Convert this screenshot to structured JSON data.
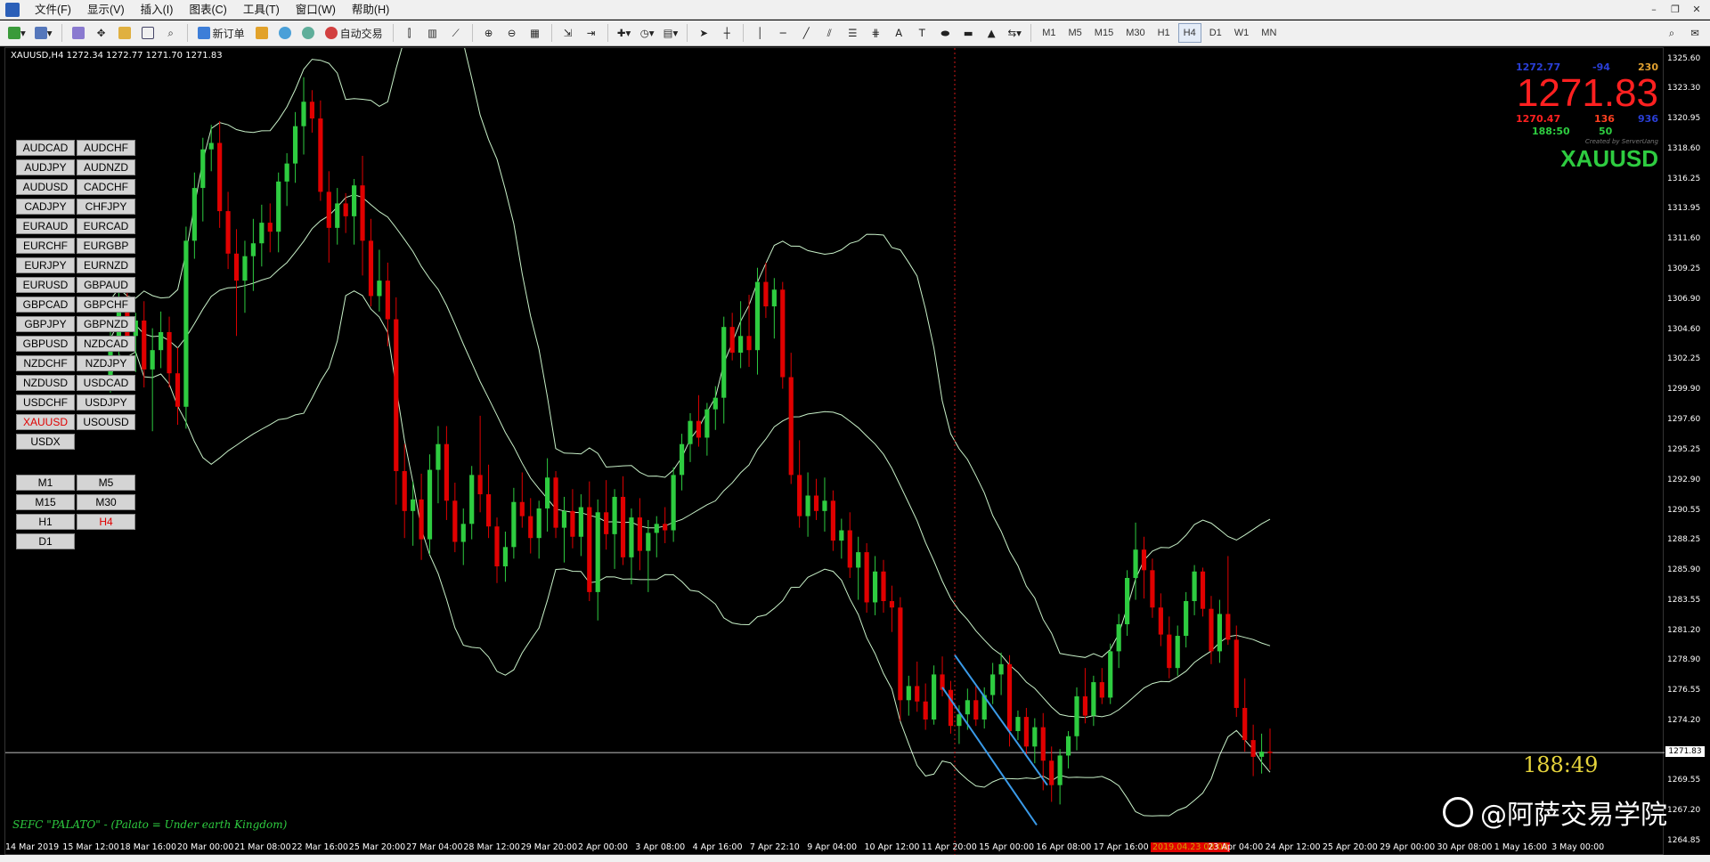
{
  "menu": [
    "文件(F)",
    "显示(V)",
    "插入(I)",
    "图表(C)",
    "工具(T)",
    "窗口(W)",
    "帮助(H)"
  ],
  "toolbar": {
    "new_order": "新订单",
    "auto_trade": "自动交易",
    "timeframes": [
      "M1",
      "M5",
      "M15",
      "M30",
      "H1",
      "H4",
      "D1",
      "W1",
      "MN"
    ],
    "active_timeframe": "H4"
  },
  "chart": {
    "header": "XAUUSD,H4  1272.34 1272.77 1271.70 1271.83",
    "watermark": "SEFC \"PALATO\" - (Palato = Under earth Kingdom)",
    "timer": "188:49",
    "current_price_label": "1271.83",
    "price_axis": [
      "1325.60",
      "1323.30",
      "1320.95",
      "1318.60",
      "1316.25",
      "1313.95",
      "1311.60",
      "1309.25",
      "1306.90",
      "1304.60",
      "1302.25",
      "1299.90",
      "1297.60",
      "1295.25",
      "1292.90",
      "1290.55",
      "1288.25",
      "1285.90",
      "1283.55",
      "1281.20",
      "1278.90",
      "1276.55",
      "1274.20",
      "1271.83",
      "1269.55",
      "1267.20",
      "1264.85"
    ],
    "time_axis": [
      "14 Mar 2019",
      "15 Mar 12:00",
      "18 Mar 16:00",
      "20 Mar 00:00",
      "21 Mar 08:00",
      "22 Mar 16:00",
      "25 Mar 20:00",
      "27 Mar 04:00",
      "28 Mar 12:00",
      "29 Mar 20:00",
      "2 Apr 00:00",
      "3 Apr 08:00",
      "4 Apr 16:00",
      "7 Apr 22:10",
      "9 Apr 04:00",
      "10 Apr 12:00",
      "11 Apr 20:00",
      "15 Apr 00:00",
      "16 Apr 08:00",
      "17 Apr 16:00",
      "2019.04.23 08:00",
      "23 Apr 04:00",
      "24 Apr 12:00",
      "25 Apr 20:00",
      "29 Apr 00:00",
      "30 Apr 08:00",
      "1 May 16:00",
      "3 May 00:00"
    ],
    "highlighted_time": "2019.04.23 08:00"
  },
  "info_panel": {
    "ask": "1272.77",
    "spread": "-94",
    "value_right": "230",
    "bid_big": "1271.83",
    "low": "1270.47",
    "pips": "136",
    "value_blue": "936",
    "timer_green": "188:50",
    "value_green": "50",
    "credit": "Created by ServerUang",
    "symbol": "XAUUSD",
    "colors": {
      "ask": "#2a3fd8",
      "spread": "#2a3fd8",
      "value_right": "#e0a030",
      "bid": "#ff2020",
      "low": "#ff2020",
      "pips": "#ff4020",
      "value_blue": "#2a3fd8",
      "green": "#2ecc40"
    }
  },
  "symbols": [
    "AUDCAD",
    "AUDCHF",
    "AUDJPY",
    "AUDNZD",
    "AUDUSD",
    "CADCHF",
    "CADJPY",
    "CHFJPY",
    "EURAUD",
    "EURCAD",
    "EURCHF",
    "EURGBP",
    "EURJPY",
    "EURNZD",
    "EURUSD",
    "GBPAUD",
    "GBPCAD",
    "GBPCHF",
    "GBPJPY",
    "GBPNZD",
    "GBPUSD",
    "NZDCAD",
    "NZDCHF",
    "NZDJPY",
    "NZDUSD",
    "USDCAD",
    "USDCHF",
    "USDJPY",
    "XAUUSD",
    "USOUSD",
    "USDX"
  ],
  "active_symbol": "XAUUSD",
  "timeframe_buttons": [
    "M1",
    "M5",
    "M15",
    "M30",
    "H1",
    "H4",
    "D1"
  ],
  "brand": "@阿萨交易学院",
  "chart_data": {
    "type": "candlestick",
    "ylim": [
      1264.85,
      1325.6
    ],
    "bull_color": "#2ecc40",
    "bear_color": "#e00000",
    "candles": [
      [
        1300.5,
        1305.2,
        1299.8,
        1304.0
      ],
      [
        1304.0,
        1307.9,
        1302.5,
        1306.6
      ],
      [
        1306.6,
        1308.3,
        1303.1,
        1304.2
      ],
      [
        1304.2,
        1306.0,
        1301.4,
        1305.4
      ],
      [
        1305.4,
        1306.9,
        1300.2,
        1301.6
      ],
      [
        1301.6,
        1304.8,
        1296.8,
        1303.1
      ],
      [
        1303.1,
        1306.1,
        1301.7,
        1304.5
      ],
      [
        1304.5,
        1305.7,
        1300.2,
        1301.3
      ],
      [
        1301.3,
        1303.3,
        1297.3,
        1298.7
      ],
      [
        1298.7,
        1312.7,
        1297.0,
        1311.6
      ],
      [
        1311.6,
        1316.9,
        1310.2,
        1315.7
      ],
      [
        1315.7,
        1319.6,
        1313.1,
        1318.7
      ],
      [
        1318.7,
        1320.6,
        1317.0,
        1319.2
      ],
      [
        1319.2,
        1320.9,
        1312.6,
        1313.9
      ],
      [
        1313.9,
        1315.4,
        1309.4,
        1310.6
      ],
      [
        1310.6,
        1312.5,
        1304.2,
        1308.5
      ],
      [
        1308.5,
        1311.6,
        1306.0,
        1310.4
      ],
      [
        1310.4,
        1313.3,
        1307.7,
        1311.4
      ],
      [
        1311.4,
        1314.4,
        1309.6,
        1313.0
      ],
      [
        1313.0,
        1314.5,
        1310.7,
        1312.3
      ],
      [
        1312.3,
        1316.9,
        1310.7,
        1316.2
      ],
      [
        1316.2,
        1318.4,
        1314.3,
        1317.6
      ],
      [
        1317.6,
        1321.6,
        1316.1,
        1320.5
      ],
      [
        1320.5,
        1324.3,
        1318.3,
        1322.4
      ],
      [
        1322.4,
        1323.3,
        1320.0,
        1321.1
      ],
      [
        1321.1,
        1322.5,
        1314.7,
        1315.4
      ],
      [
        1315.4,
        1317.0,
        1309.9,
        1312.6
      ],
      [
        1312.6,
        1315.7,
        1311.3,
        1314.5
      ],
      [
        1314.5,
        1315.3,
        1312.2,
        1313.5
      ],
      [
        1313.5,
        1316.4,
        1311.3,
        1315.9
      ],
      [
        1315.9,
        1318.2,
        1308.9,
        1311.6
      ],
      [
        1311.6,
        1313.3,
        1306.5,
        1307.3
      ],
      [
        1307.3,
        1310.9,
        1306.1,
        1308.5
      ],
      [
        1308.5,
        1309.9,
        1303.4,
        1305.5
      ],
      [
        1305.5,
        1307.2,
        1291.1,
        1293.7
      ],
      [
        1293.7,
        1295.8,
        1288.5,
        1290.6
      ],
      [
        1290.6,
        1292.9,
        1287.9,
        1291.5
      ],
      [
        1291.5,
        1293.5,
        1286.8,
        1288.4
      ],
      [
        1288.4,
        1295.0,
        1287.2,
        1293.8
      ],
      [
        1293.8,
        1297.2,
        1291.2,
        1295.8
      ],
      [
        1295.8,
        1297.2,
        1289.9,
        1291.4
      ],
      [
        1291.4,
        1292.8,
        1287.4,
        1288.2
      ],
      [
        1288.2,
        1290.8,
        1286.4,
        1289.6
      ],
      [
        1289.6,
        1294.1,
        1288.4,
        1293.4
      ],
      [
        1293.4,
        1298.0,
        1290.5,
        1291.9
      ],
      [
        1291.9,
        1294.2,
        1288.5,
        1289.4
      ],
      [
        1289.4,
        1290.1,
        1285.0,
        1286.3
      ],
      [
        1286.3,
        1289.0,
        1285.1,
        1287.8
      ],
      [
        1287.8,
        1292.4,
        1286.9,
        1291.3
      ],
      [
        1291.3,
        1293.6,
        1289.3,
        1290.2
      ],
      [
        1290.2,
        1291.6,
        1287.3,
        1288.5
      ],
      [
        1288.5,
        1291.4,
        1286.9,
        1290.8
      ],
      [
        1290.8,
        1294.7,
        1289.0,
        1293.2
      ],
      [
        1293.2,
        1293.7,
        1288.5,
        1289.3
      ],
      [
        1289.3,
        1291.7,
        1286.6,
        1290.6
      ],
      [
        1290.6,
        1292.3,
        1287.7,
        1288.6
      ],
      [
        1288.6,
        1291.9,
        1287.1,
        1290.9
      ],
      [
        1290.9,
        1292.9,
        1283.6,
        1284.3
      ],
      [
        1284.3,
        1291.5,
        1282.1,
        1290.5
      ],
      [
        1290.5,
        1293.0,
        1287.6,
        1288.8
      ],
      [
        1288.8,
        1292.3,
        1286.1,
        1291.7
      ],
      [
        1291.7,
        1293.3,
        1286.4,
        1287.0
      ],
      [
        1287.0,
        1290.8,
        1284.9,
        1290.1
      ],
      [
        1290.1,
        1291.6,
        1286.0,
        1287.5
      ],
      [
        1287.5,
        1289.9,
        1284.3,
        1288.9
      ],
      [
        1288.9,
        1290.2,
        1287.0,
        1289.6
      ],
      [
        1289.6,
        1290.9,
        1288.1,
        1289.1
      ],
      [
        1289.1,
        1294.0,
        1288.2,
        1293.4
      ],
      [
        1293.4,
        1296.6,
        1292.2,
        1295.8
      ],
      [
        1295.8,
        1298.2,
        1294.4,
        1297.6
      ],
      [
        1297.6,
        1299.6,
        1295.6,
        1296.3
      ],
      [
        1296.3,
        1299.0,
        1294.9,
        1298.5
      ],
      [
        1298.5,
        1300.3,
        1296.9,
        1299.4
      ],
      [
        1299.4,
        1305.7,
        1297.4,
        1304.9
      ],
      [
        1304.9,
        1306.0,
        1302.3,
        1302.9
      ],
      [
        1302.9,
        1306.9,
        1301.7,
        1304.2
      ],
      [
        1304.2,
        1307.4,
        1301.8,
        1303.1
      ],
      [
        1303.1,
        1309.5,
        1301.2,
        1308.4
      ],
      [
        1308.4,
        1309.9,
        1305.6,
        1306.5
      ],
      [
        1306.5,
        1308.7,
        1304.0,
        1307.8
      ],
      [
        1307.8,
        1308.4,
        1300.1,
        1301.0
      ],
      [
        1301.0,
        1302.9,
        1292.7,
        1293.4
      ],
      [
        1293.4,
        1296.1,
        1289.3,
        1290.2
      ],
      [
        1290.2,
        1293.6,
        1288.6,
        1291.8
      ],
      [
        1291.8,
        1293.1,
        1289.9,
        1290.6
      ],
      [
        1290.6,
        1293.2,
        1289.0,
        1291.4
      ],
      [
        1291.4,
        1292.2,
        1287.5,
        1288.3
      ],
      [
        1288.3,
        1290.0,
        1286.9,
        1289.1
      ],
      [
        1289.1,
        1290.5,
        1285.4,
        1286.2
      ],
      [
        1286.2,
        1288.6,
        1283.7,
        1287.4
      ],
      [
        1287.4,
        1288.1,
        1282.7,
        1283.5
      ],
      [
        1283.5,
        1287.1,
        1282.5,
        1285.9
      ],
      [
        1285.9,
        1286.8,
        1282.7,
        1283.6
      ],
      [
        1283.6,
        1284.8,
        1281.2,
        1283.1
      ],
      [
        1283.1,
        1283.9,
        1274.3,
        1275.9
      ],
      [
        1275.9,
        1277.8,
        1274.7,
        1277.0
      ],
      [
        1277.0,
        1278.9,
        1275.0,
        1275.8
      ],
      [
        1275.8,
        1277.2,
        1273.6,
        1274.4
      ],
      [
        1274.4,
        1278.6,
        1274.0,
        1277.9
      ],
      [
        1277.9,
        1279.3,
        1276.2,
        1276.7
      ],
      [
        1276.7,
        1277.4,
        1273.3,
        1273.9
      ],
      [
        1273.9,
        1275.5,
        1272.5,
        1274.8
      ],
      [
        1274.8,
        1276.8,
        1273.6,
        1275.9
      ],
      [
        1275.9,
        1277.0,
        1273.9,
        1274.4
      ],
      [
        1274.4,
        1276.9,
        1273.7,
        1276.3
      ],
      [
        1276.3,
        1278.8,
        1275.6,
        1277.9
      ],
      [
        1277.9,
        1279.6,
        1276.3,
        1278.7
      ],
      [
        1278.7,
        1279.4,
        1272.3,
        1273.5
      ],
      [
        1273.5,
        1275.1,
        1272.8,
        1274.6
      ],
      [
        1274.6,
        1275.3,
        1271.6,
        1272.3
      ],
      [
        1272.3,
        1274.5,
        1271.0,
        1273.8
      ],
      [
        1273.8,
        1274.9,
        1268.9,
        1271.2
      ],
      [
        1271.2,
        1272.3,
        1268.0,
        1269.3
      ],
      [
        1269.3,
        1272.1,
        1267.8,
        1271.6
      ],
      [
        1271.6,
        1273.5,
        1270.6,
        1273.1
      ],
      [
        1273.1,
        1276.9,
        1272.0,
        1276.2
      ],
      [
        1276.2,
        1278.4,
        1274.1,
        1274.7
      ],
      [
        1274.7,
        1277.8,
        1273.9,
        1277.3
      ],
      [
        1277.3,
        1278.4,
        1275.6,
        1276.1
      ],
      [
        1276.1,
        1280.3,
        1275.6,
        1279.7
      ],
      [
        1279.7,
        1282.6,
        1278.4,
        1281.8
      ],
      [
        1281.8,
        1286.0,
        1280.9,
        1285.4
      ],
      [
        1285.4,
        1289.7,
        1283.7,
        1287.6
      ],
      [
        1287.6,
        1288.6,
        1283.8,
        1286.0
      ],
      [
        1286.0,
        1286.9,
        1282.3,
        1283.1
      ],
      [
        1283.1,
        1284.2,
        1280.1,
        1281.0
      ],
      [
        1281.0,
        1282.4,
        1277.6,
        1278.4
      ],
      [
        1278.4,
        1281.7,
        1277.8,
        1280.9
      ],
      [
        1280.9,
        1284.3,
        1280.0,
        1283.6
      ],
      [
        1283.6,
        1286.4,
        1282.5,
        1285.9
      ],
      [
        1285.9,
        1286.2,
        1282.4,
        1283.0
      ],
      [
        1283.0,
        1284.0,
        1278.7,
        1279.7
      ],
      [
        1279.7,
        1283.7,
        1278.8,
        1282.6
      ],
      [
        1282.6,
        1287.1,
        1280.2,
        1280.6
      ],
      [
        1280.6,
        1281.7,
        1274.6,
        1275.3
      ],
      [
        1275.3,
        1277.6,
        1271.9,
        1272.8
      ],
      [
        1272.8,
        1274.0,
        1270.0,
        1271.5
      ],
      [
        1271.5,
        1273.3,
        1270.2,
        1271.9
      ],
      [
        1271.9,
        1273.7,
        1270.5,
        1271.8
      ]
    ]
  }
}
